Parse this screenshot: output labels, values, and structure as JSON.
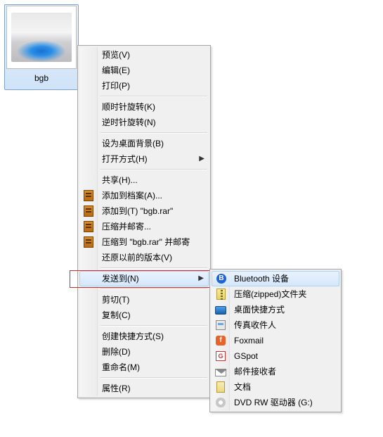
{
  "file": {
    "name": "bgb"
  },
  "context_menu": {
    "groups": [
      [
        {
          "id": "preview",
          "label": "预览(V)"
        },
        {
          "id": "edit",
          "label": "编辑(E)"
        },
        {
          "id": "print",
          "label": "打印(P)"
        }
      ],
      [
        {
          "id": "rotate-cw",
          "label": "顺时针旋转(K)"
        },
        {
          "id": "rotate-ccw",
          "label": "逆时针旋转(N)"
        }
      ],
      [
        {
          "id": "set-wallpaper",
          "label": "设为桌面背景(B)"
        },
        {
          "id": "open-with",
          "label": "打开方式(H)",
          "submenu": true
        }
      ],
      [
        {
          "id": "share",
          "label": "共享(H)..."
        },
        {
          "id": "rar-add",
          "label": "添加到档案(A)...",
          "icon": "rar"
        },
        {
          "id": "rar-add-named",
          "label": "添加到(T) \"bgb.rar\"",
          "icon": "rar"
        },
        {
          "id": "rar-email",
          "label": "压缩并邮寄...",
          "icon": "rar"
        },
        {
          "id": "rar-email-named",
          "label": "压缩到 \"bgb.rar\" 并邮寄",
          "icon": "rar"
        },
        {
          "id": "prev-versions",
          "label": "还原以前的版本(V)"
        }
      ],
      [
        {
          "id": "send-to",
          "label": "发送到(N)",
          "submenu": true,
          "highlight": true
        }
      ],
      [
        {
          "id": "cut",
          "label": "剪切(T)"
        },
        {
          "id": "copy",
          "label": "复制(C)"
        }
      ],
      [
        {
          "id": "shortcut",
          "label": "创建快捷方式(S)"
        },
        {
          "id": "delete",
          "label": "删除(D)"
        },
        {
          "id": "rename",
          "label": "重命名(M)"
        }
      ],
      [
        {
          "id": "properties",
          "label": "属性(R)"
        }
      ]
    ]
  },
  "sendto_menu": {
    "items": [
      {
        "id": "bluetooth",
        "label": "Bluetooth 设备",
        "icon": "bt",
        "highlight": true
      },
      {
        "id": "zip",
        "label": "压缩(zipped)文件夹",
        "icon": "zip"
      },
      {
        "id": "desktop",
        "label": "桌面快捷方式",
        "icon": "desk"
      },
      {
        "id": "fax",
        "label": "传真收件人",
        "icon": "fax"
      },
      {
        "id": "foxmail",
        "label": "Foxmail",
        "icon": "fox"
      },
      {
        "id": "gspot",
        "label": "GSpot",
        "icon": "gspot"
      },
      {
        "id": "mail",
        "label": "邮件接收者",
        "icon": "mail"
      },
      {
        "id": "documents",
        "label": "文档",
        "icon": "doc"
      },
      {
        "id": "dvdrw",
        "label": "DVD RW 驱动器 (G:)",
        "icon": "dvd"
      }
    ]
  }
}
